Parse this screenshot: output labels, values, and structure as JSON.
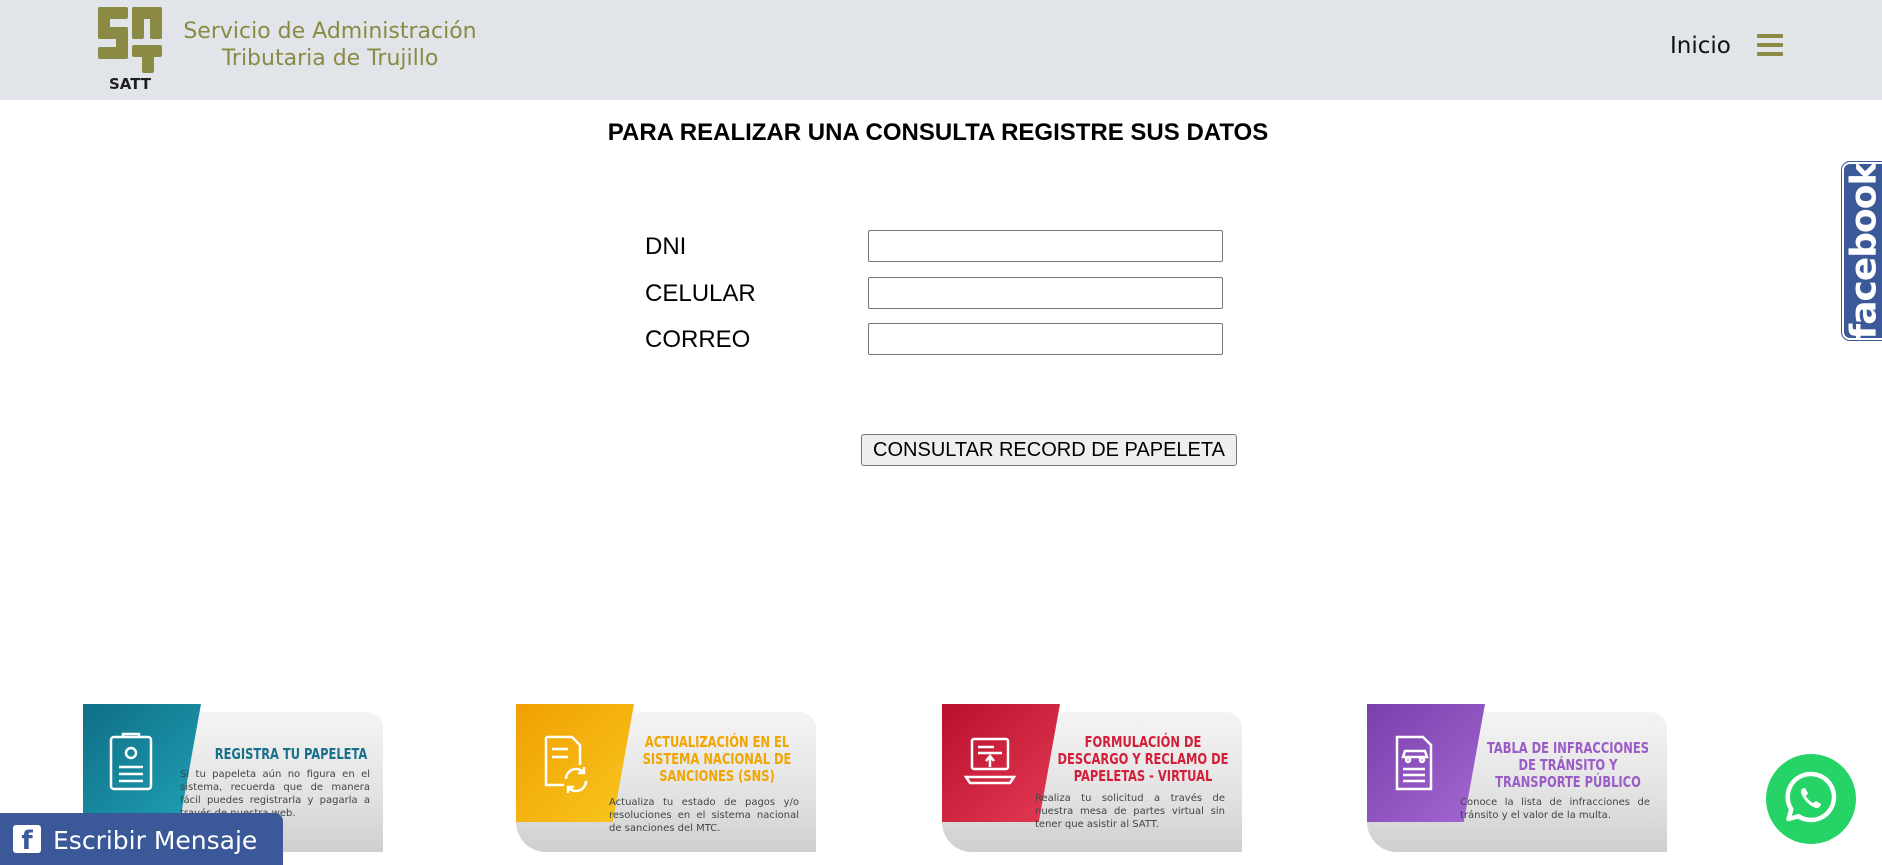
{
  "header": {
    "logo_alt": "SATT",
    "org_line1": "Servicio de Administración",
    "org_line2": "Tributaria de Trujillo",
    "nav_inicio": "Inicio",
    "menu_icon": "hamburger-icon",
    "brand_color": "#8a8a45"
  },
  "form": {
    "title": "PARA REALIZAR UNA CONSULTA REGISTRE SUS DATOS",
    "dni_label": "DNI",
    "dni_value": "",
    "celular_label": "CELULAR",
    "celular_value": "",
    "correo_label": "CORREO",
    "correo_value": "",
    "submit_label": "CONSULTAR RECORD DE PAPELETA"
  },
  "side_facebook": {
    "label": "facebook",
    "color": "#3b5998"
  },
  "cards": [
    {
      "title": "REGISTRA TU PAPELETA",
      "desc": "Si tu papeleta aún no figura en el sistema, recuerda que de manera fácil puedes registrarla y pagarla a través de nuestra web.",
      "color": "#1a8a9e",
      "title_color": "#1a6f8a",
      "icon": "document-badge-icon"
    },
    {
      "title": "ACTUALIZACIÓN EN EL SISTEMA NACIONAL DE SANCIONES (SNS)",
      "desc": "Actualiza tu estado de pagos y/o resoluciones en el sistema nacional de sanciones del MTC.",
      "color": "#f5b50f",
      "title_color": "#f0a500",
      "icon": "document-refresh-icon"
    },
    {
      "title": "FORMULACIÓN DE DESCARGO Y RECLAMO DE PAPELETAS - VIRTUAL",
      "desc": "Realiza tu solicitud a través de nuestra mesa de partes virtual sin tener que asistir al SATT.",
      "color": "#d9233f",
      "title_color": "#d11f3a",
      "icon": "laptop-document-icon"
    },
    {
      "title": "TABLA DE INFRACCIONES DE TRÁNSITO Y TRANSPORTE PÚBLICO",
      "desc": "Conoce la lista de infracciones de tránsito y el valor de la multa.",
      "color": "#8e4fbd",
      "title_color": "#9a5cc6",
      "icon": "car-checklist-icon"
    }
  ],
  "message_bar": {
    "label": "Escribir Mensaje",
    "icon": "facebook-icon",
    "color": "#3b5998"
  },
  "whatsapp": {
    "icon": "whatsapp-icon",
    "color": "#25d366"
  }
}
